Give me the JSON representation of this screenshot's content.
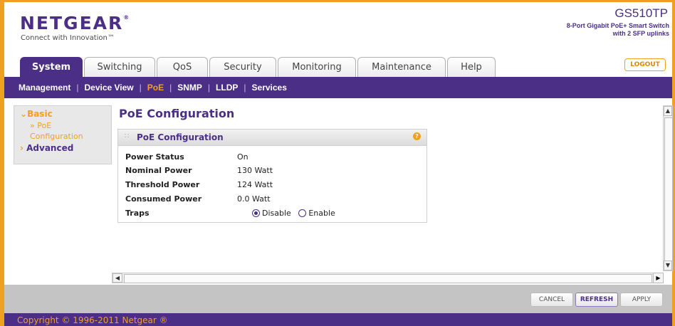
{
  "brand": {
    "logo": "NETGEAR",
    "tagline": "Connect with Innovation™",
    "model": "GS510TP",
    "model_desc_line1": "8-Port Gigabit PoE+ Smart Switch",
    "model_desc_line2": "with 2 SFP uplinks",
    "accent": "#4b2f87",
    "highlight": "#f0a020"
  },
  "tabs": [
    "System",
    "Switching",
    "QoS",
    "Security",
    "Monitoring",
    "Maintenance",
    "Help"
  ],
  "active_tab": "System",
  "logout_label": "LOGOUT",
  "subnav": [
    "Management",
    "Device View",
    "PoE",
    "SNMP",
    "LLDP",
    "Services"
  ],
  "active_subnav": "PoE",
  "sidebar": {
    "basic": "Basic",
    "poe_line1": "» PoE",
    "poe_line2": "Configuration",
    "advanced": "Advanced"
  },
  "page_title": "PoE Configuration",
  "panel": {
    "title": "PoE Configuration",
    "help_icon": "?",
    "rows": [
      {
        "label": "Power Status",
        "value": "On"
      },
      {
        "label": "Nominal Power",
        "value": "130 Watt"
      },
      {
        "label": "Threshold Power",
        "value": "124 Watt"
      },
      {
        "label": "Consumed Power",
        "value": "0.0 Watt"
      }
    ],
    "traps_label": "Traps",
    "traps_options": [
      "Disable",
      "Enable"
    ],
    "traps_selected": "Disable"
  },
  "actions": {
    "cancel": "CANCEL",
    "refresh": "REFRESH",
    "apply": "APPLY"
  },
  "footer": "Copyright © 1996-2011 Netgear ®"
}
